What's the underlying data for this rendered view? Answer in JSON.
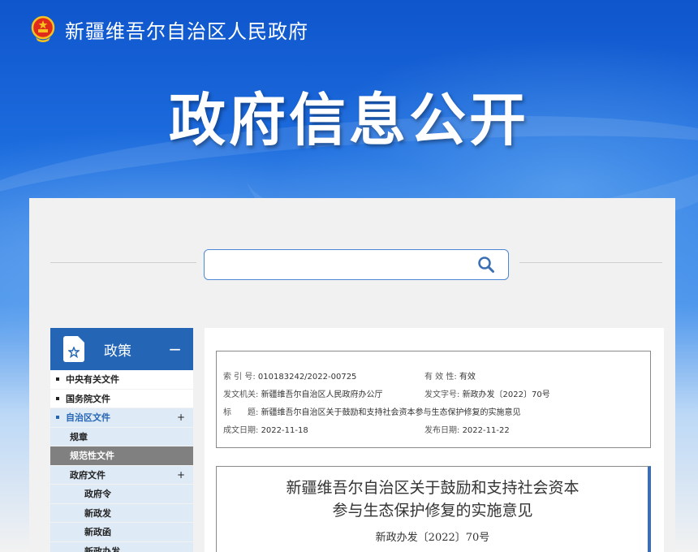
{
  "header": {
    "site_name": "新疆维吾尔自治区人民政府",
    "banner_title": "政府信息公开"
  },
  "search": {
    "placeholder": ""
  },
  "sidebar": {
    "title": "政策",
    "collapse_symbol": "−",
    "items": [
      {
        "label": "中央有关文件"
      },
      {
        "label": "国务院文件"
      },
      {
        "label": "自治区文件",
        "expand": "+"
      },
      {
        "label": "规章"
      },
      {
        "label": "规范性文件"
      },
      {
        "label": "政府文件",
        "expand": "+"
      },
      {
        "label": "政府令"
      },
      {
        "label": "新政发"
      },
      {
        "label": "新政函"
      },
      {
        "label": "新政办发"
      }
    ]
  },
  "meta": {
    "index_key": "索 引 号:",
    "index_val": "010183242/2022-00725",
    "validity_key": "有 效 性:",
    "validity_val": "有效",
    "issuer_key": "发文机关:",
    "issuer_val": "新疆维吾尔自治区人民政府办公厅",
    "docno_key": "发文字号:",
    "docno_val": "新政办发〔2022〕70号",
    "title_key": "标　　题:",
    "title_val": "新疆维吾尔自治区关于鼓励和支持社会资本参与生态保护修复的实施意见",
    "created_key": "成文日期:",
    "created_val": "2022-11-18",
    "published_key": "发布日期:",
    "published_val": "2022-11-22"
  },
  "document": {
    "title_line1": "新疆维吾尔自治区关于鼓励和支持社会资本",
    "title_line2": "参与生态保护修复的实施意见",
    "doc_number": "新政办发〔2022〕70号"
  },
  "colors": {
    "banner_blue": "#1e6fe0",
    "sidebar_header": "#2466b5",
    "sidebar_active_bg": "#dfeaf7",
    "sidebar_selected_bg": "#808080"
  }
}
